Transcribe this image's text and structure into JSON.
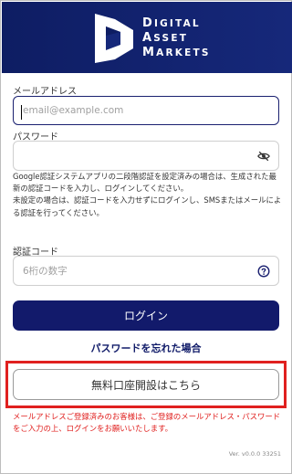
{
  "brand": {
    "line1": "Digital",
    "line2": "Asset",
    "line3": "Markets",
    "colors": {
      "primary": "#121a6b",
      "header": "#16287a",
      "alert": "#e0201f"
    }
  },
  "email": {
    "label": "メールアドレス",
    "placeholder": "email@example.com",
    "value": ""
  },
  "password": {
    "label": "パスワード",
    "value": "",
    "toggle_icon": "eye-off-icon"
  },
  "notice": {
    "line1": "Google認証システムアプリの二段階認証を設定済みの場合は、生成された最新の認証コードを入力し、ログインしてください。",
    "line2": "未設定の場合は、認証コードを入力せずにログインし、SMSまたはメールによる認証を行ってください。"
  },
  "auth_code": {
    "label": "認証コード",
    "placeholder": "6桁の数字",
    "help_icon": "question-circle-icon"
  },
  "actions": {
    "login_label": "ログイン",
    "forgot_label": "パスワードを忘れた場合",
    "signup_label": "無料口座開設はこちら"
  },
  "warning": "メールアドレスご登録済みのお客様は、ご登録のメールアドレス・パスワードをご入力の上、ログインをお願いいたします。",
  "version": "Ver. v0.0.0 33251"
}
